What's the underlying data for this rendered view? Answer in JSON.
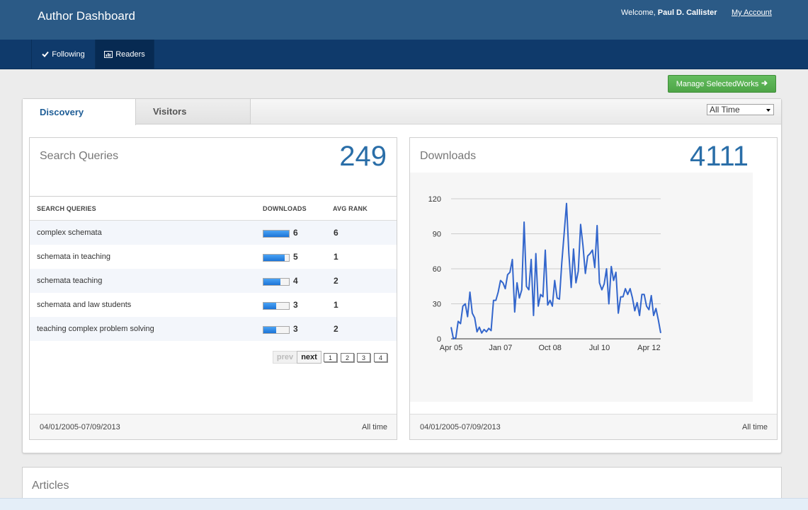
{
  "header": {
    "app_title": "Author Dashboard",
    "welcome_prefix": "Welcome, ",
    "user_name": "Paul D. Callister",
    "my_account": "My Account"
  },
  "nav": {
    "following": "Following",
    "readers": "Readers",
    "active": "Readers"
  },
  "manage_button": "Manage SelectedWorks",
  "tabs": {
    "discovery": "Discovery",
    "visitors": "Visitors",
    "active": "Discovery"
  },
  "time_filter": {
    "selected": "All Time"
  },
  "search_queries": {
    "title": "Search Queries",
    "total": "249",
    "columns": {
      "query": "SEARCH QUERIES",
      "downloads": "DOWNLOADS",
      "rank": "AVG RANK"
    },
    "rows": [
      {
        "query": "complex schemata",
        "downloads": "6",
        "rank": "6",
        "bar_fraction": 1.0
      },
      {
        "query": "schemata in teaching",
        "downloads": "5",
        "rank": "1",
        "bar_fraction": 0.83
      },
      {
        "query": "schemata teaching",
        "downloads": "4",
        "rank": "2",
        "bar_fraction": 0.67
      },
      {
        "query": "schemata and law students",
        "downloads": "3",
        "rank": "1",
        "bar_fraction": 0.5
      },
      {
        "query": "teaching complex problem solving",
        "downloads": "3",
        "rank": "2",
        "bar_fraction": 0.5
      }
    ],
    "pager": {
      "prev": "prev",
      "next": "next",
      "pages": [
        "1",
        "2",
        "3",
        "4"
      ]
    },
    "footer_range": "04/01/2005-07/09/2013",
    "footer_all": "All time"
  },
  "downloads": {
    "title": "Downloads",
    "total": "4111",
    "footer_range": "04/01/2005-07/09/2013",
    "footer_all": "All time"
  },
  "chart_data": {
    "type": "line",
    "title": "",
    "xlabel": "",
    "ylabel": "",
    "ylim": [
      0,
      120
    ],
    "yticks": [
      0,
      30,
      60,
      90,
      120
    ],
    "x_tick_labels": [
      "Apr 05",
      "Jan 07",
      "Oct 08",
      "Jul 10",
      "Apr 12"
    ],
    "x_tick_index": [
      0,
      21,
      42,
      63,
      84
    ],
    "grid": true,
    "line_color": "#3366cc",
    "series": [
      {
        "values": [
          10,
          0,
          1,
          15,
          13,
          28,
          30,
          19,
          40,
          22,
          18,
          6,
          10,
          5,
          8,
          6,
          9,
          7,
          33,
          33,
          40,
          50,
          48,
          43,
          55,
          57,
          68,
          23,
          48,
          35,
          42,
          100,
          45,
          42,
          68,
          20,
          73,
          28,
          38,
          36,
          76,
          29,
          33,
          28,
          50,
          35,
          34,
          65,
          90,
          116,
          73,
          44,
          77,
          48,
          58,
          98,
          80,
          56,
          71,
          73,
          76,
          61,
          97,
          48,
          42,
          47,
          60,
          30,
          62,
          50,
          57,
          22,
          36,
          36,
          43,
          38,
          43,
          35,
          24,
          31,
          20,
          38,
          38,
          28,
          25,
          37,
          20,
          26,
          16,
          5
        ]
      }
    ]
  },
  "articles": {
    "title": "Articles"
  }
}
